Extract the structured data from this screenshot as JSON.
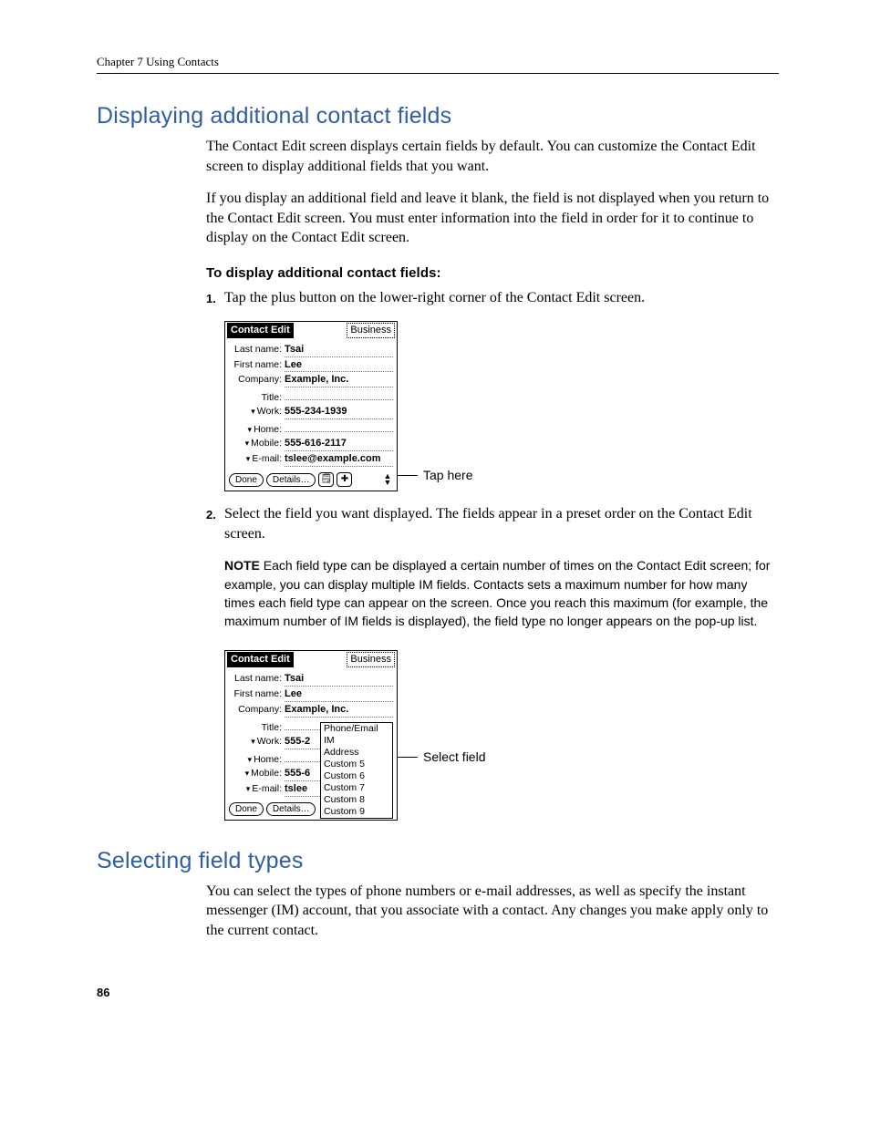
{
  "header": {
    "running": "Chapter 7   Using Contacts"
  },
  "section1": {
    "title": "Displaying additional contact fields",
    "p1": "The Contact Edit screen displays certain fields by default. You can customize the Contact Edit screen to display additional fields that you want.",
    "p2": "If you display an additional field and leave it blank, the field is not displayed when you return to the Contact Edit screen. You must enter information into the field in order for it to continue to display on the Contact Edit screen.",
    "subhead": "To display additional contact fields:",
    "step1_num": "1.",
    "step1_txt": "Tap the plus button on the lower-right corner of the Contact Edit screen.",
    "step2_num": "2.",
    "step2_txt": "Select the field you want displayed. The fields appear in a preset order on the Contact Edit screen.",
    "note_label": "NOTE",
    "note_text": " Each field type can be displayed a certain number of times on the Contact Edit screen; for example, you can display multiple IM fields. Contacts sets a maximum number for how many times each field type can appear on the screen. Once you reach this maximum (for example, the maximum number of IM fields is displayed), the field type no longer appears on the pop-up list."
  },
  "section2": {
    "title": "Selecting field types",
    "p1": "You can select the types of phone numbers or e-mail addresses, as well as specify the instant messenger (IM) account, that you associate with a contact. Any changes you make apply only to the current contact."
  },
  "palm": {
    "title": "Contact Edit",
    "category": "Business",
    "rows": {
      "last_lbl": "Last name:",
      "last_val": "Tsai",
      "first_lbl": "First name:",
      "first_val": "Lee",
      "company_lbl": "Company:",
      "company_val": "Example, Inc.",
      "title_lbl": "Title:",
      "title_val": "",
      "work_lbl": "Work:",
      "work_val": "555-234-1939",
      "home_lbl": "Home:",
      "home_val": "",
      "mobile_lbl": "Mobile:",
      "mobile_val": "555-616-2117",
      "email_lbl": "E-mail:",
      "email_val": "tslee@example.com"
    },
    "buttons": {
      "done": "Done",
      "details": "Details…",
      "note": "🗒",
      "plus": "✚"
    },
    "callout1": "Tap here",
    "callout2": "Select field",
    "popup": [
      "Phone/Email",
      "IM",
      "Address",
      "Custom 5",
      "Custom 6",
      "Custom 7",
      "Custom 8",
      "Custom 9"
    ],
    "trunc": {
      "work": "555-2",
      "mobile": "555-6",
      "email": "tslee"
    }
  },
  "page_number": "86"
}
